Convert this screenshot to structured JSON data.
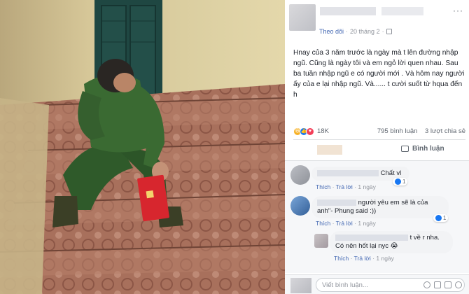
{
  "post": {
    "follow_label": "Theo dõi",
    "separator": "·",
    "timestamp": "20 tháng 2",
    "caption": "Hnay của 3 năm trước là ngày mà t lên đường nhập ngũ. Cũng là ngày tôi và em ngỏ lời quen nhau. Sau ba tuần nhập ngũ e có người mới . Và hôm nay người ấy của e lại nhập ngũ. Và...... t cười suốt từ hqua đến h",
    "reaction_count": "18K",
    "comment_count": "795 bình luận",
    "share_count": "3 lượt chia sẻ",
    "comment_button": "Bình luận",
    "more": "···"
  },
  "comments": [
    {
      "text": "Chất vl",
      "like_label": "Thích",
      "reply_label": "Trả lời",
      "time": "1 ngày",
      "reaction_count": "1"
    },
    {
      "text_line1": "người yêu em sẽ là của",
      "text_line2": "anh\"- Phung said :))",
      "like_label": "Thích",
      "reply_label": "Trả lời",
      "time": "1 ngày",
      "reaction_count": "1"
    },
    {
      "text_line1": "t về r nha.",
      "text_line2": "Có nên hốt lại nyc 😭",
      "like_label": "Thích",
      "reply_label": "Trả lời",
      "time": "1 ngày"
    }
  ],
  "write_comment": {
    "placeholder": "Viết bình luận..."
  },
  "icons": {
    "reactions": [
      "haha-icon",
      "like-icon",
      "love-icon"
    ],
    "write": [
      "emoji-icon",
      "camera-icon",
      "gif-icon",
      "sticker-icon"
    ]
  },
  "colors": {
    "link": "#4267b2",
    "meta": "#90949c",
    "like": "#1877f2"
  }
}
